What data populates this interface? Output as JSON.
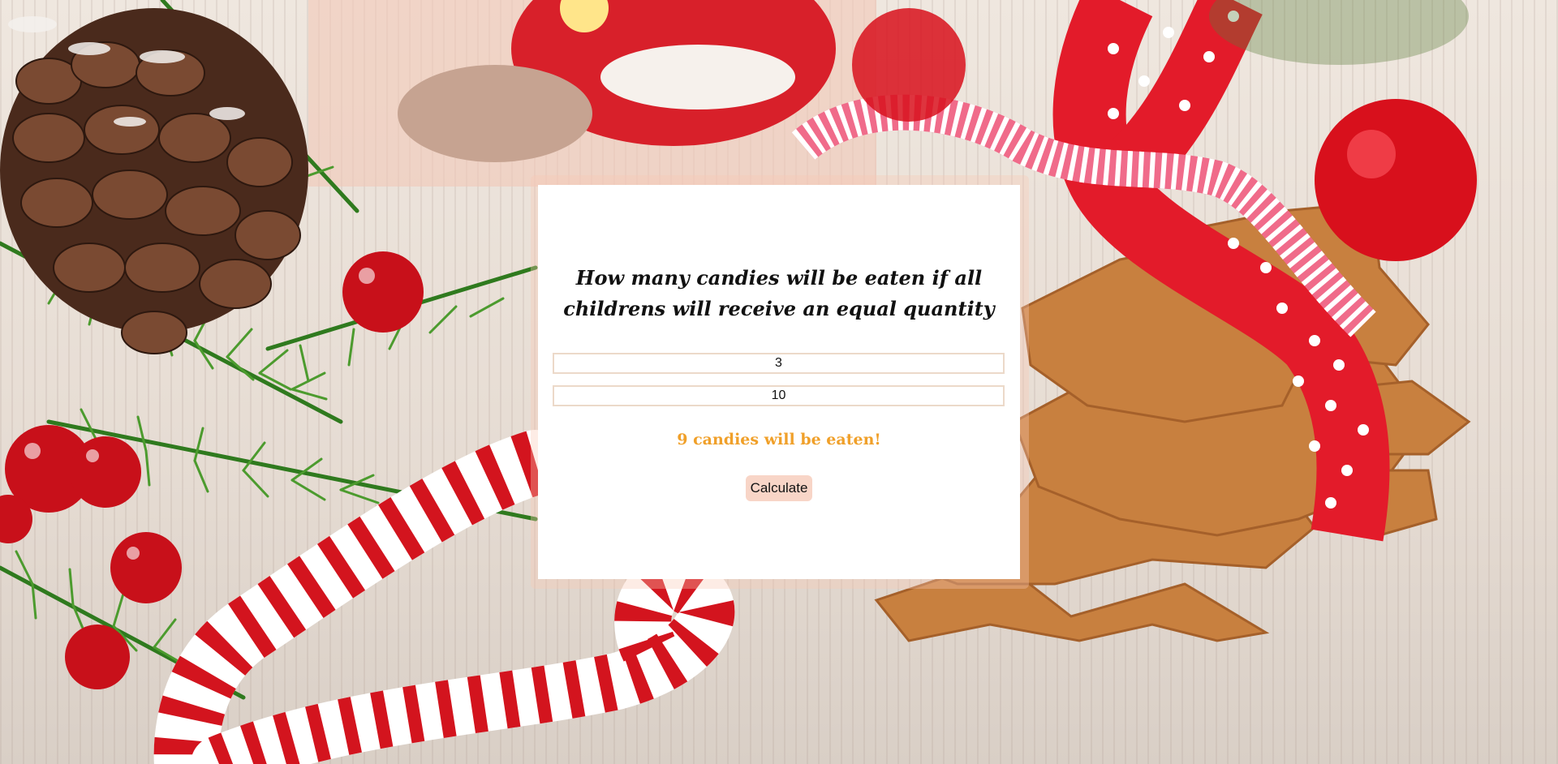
{
  "panel": {
    "question": "How many candies will be eaten if all childrens will receive an equal quantity",
    "input_children_value": "3",
    "input_candies_value": "10",
    "result_text": "9 candies will be eaten!",
    "calculate_label": "Calculate"
  },
  "colors": {
    "result": "#f0a02a",
    "button_bg": "#f8d5c7",
    "field_border": "#ecd9c9"
  }
}
